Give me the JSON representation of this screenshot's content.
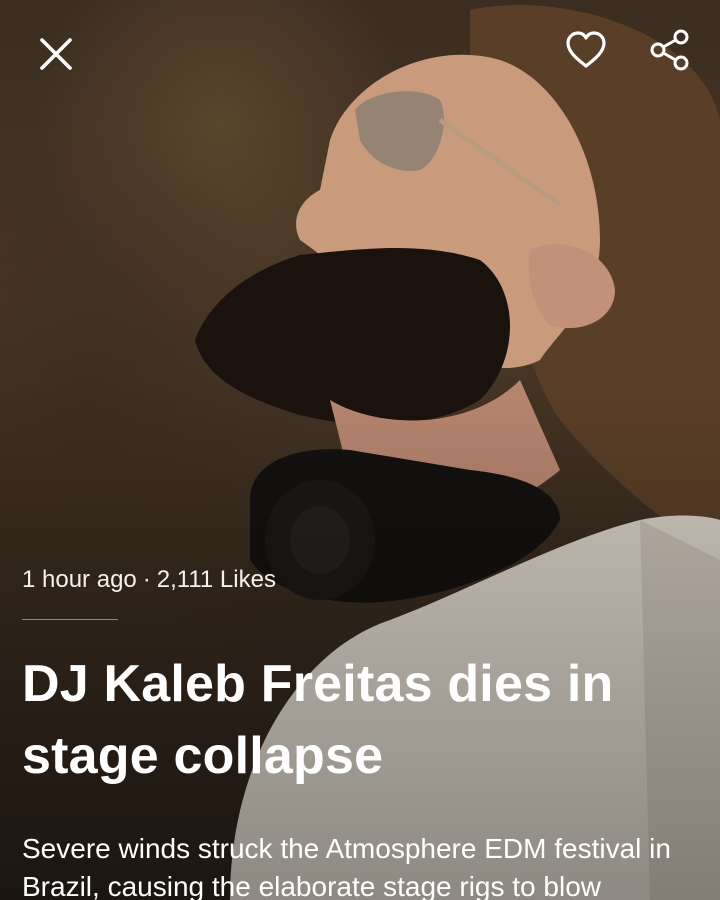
{
  "toolbar": {
    "close_icon": "close-icon",
    "like_icon": "heart-outline-icon",
    "share_icon": "share-icon"
  },
  "article": {
    "time_ago": "1 hour ago",
    "separator": "·",
    "likes": "2,111 Likes",
    "headline": "DJ Kaleb Freitas dies in stage collapse",
    "summary": "Severe winds struck the Atmosphere EDM festival in Brazil, causing the elaborate stage rigs to blow"
  },
  "colors": {
    "text": "#ffffff",
    "background": "#3b2d1f"
  }
}
